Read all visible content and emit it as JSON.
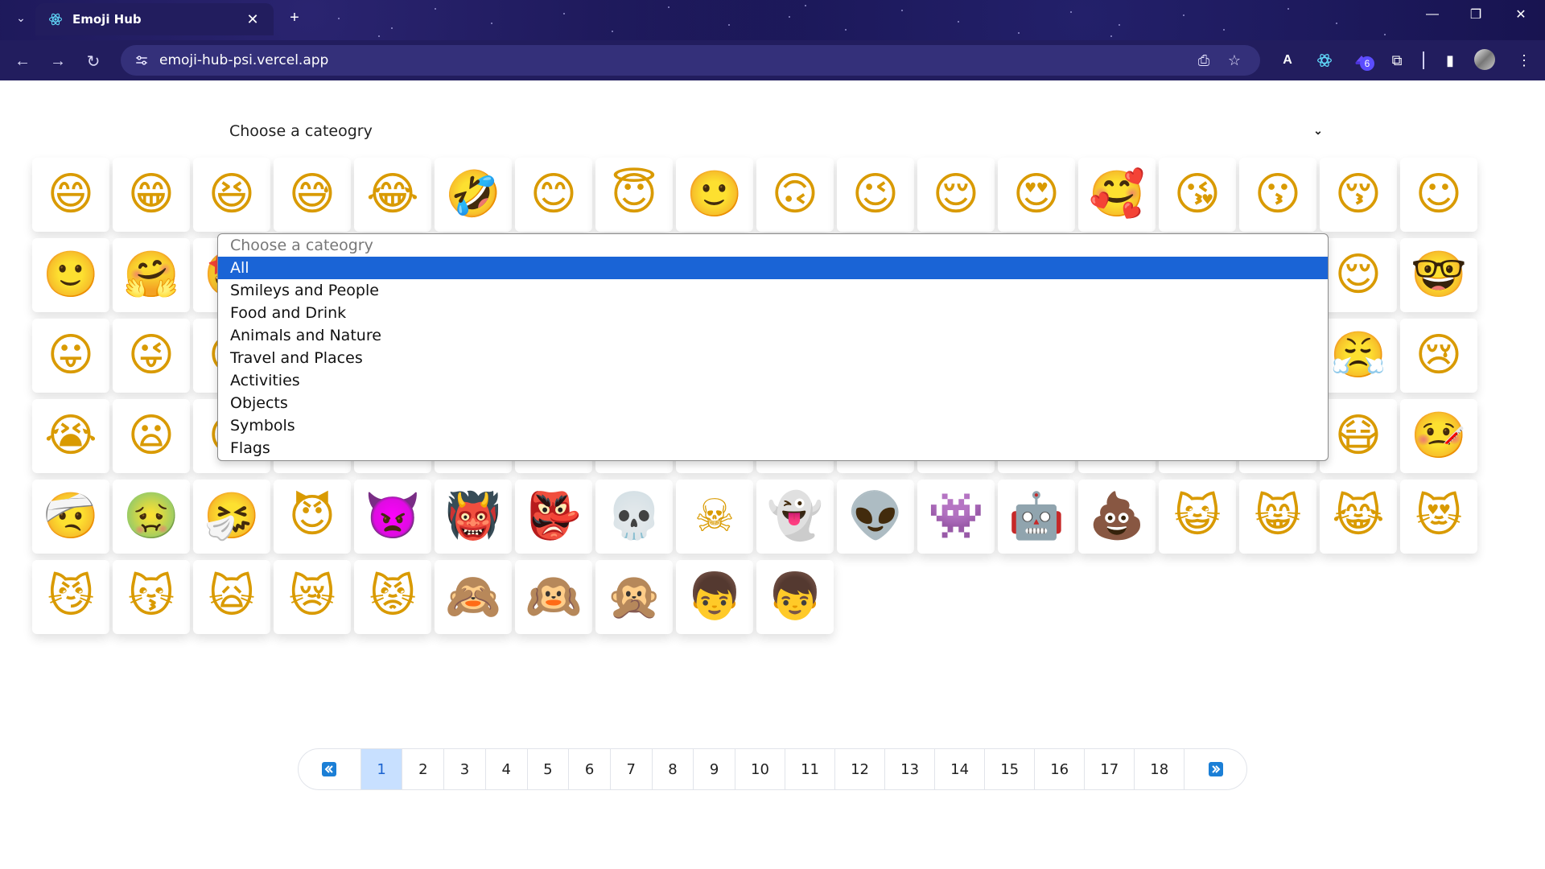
{
  "browser": {
    "tab_title": "Emoji Hub",
    "url": "emoji-hub-psi.vercel.app",
    "extension_badge": "6"
  },
  "category_select": {
    "placeholder": "Choose a cateogry",
    "options": [
      "Choose a cateogry",
      "All",
      "Smileys and People",
      "Food and Drink",
      "Animals and Nature",
      "Travel and Places",
      "Activities",
      "Objects",
      "Symbols",
      "Flags"
    ],
    "highlighted": "All"
  },
  "emojis": [
    [
      "😄",
      "😁",
      "😆",
      "😅",
      "😂",
      "🤣",
      "😊",
      "😇",
      "🙂",
      "🙃",
      "😉",
      "😌",
      "😍",
      "🥰",
      "😘",
      "😗",
      "😚",
      "☺"
    ],
    [
      "🙂",
      "🤗",
      "🤩",
      "🤔",
      "🤨",
      "😐",
      "😑",
      "😶",
      "🙄",
      "😏",
      "😣",
      "😥",
      "😮",
      "🤐",
      "😯",
      "😪",
      "😌",
      "🤓"
    ],
    [
      "😛",
      "😜",
      "😝",
      "🤤",
      "😒",
      "😓",
      "😔",
      "😕",
      "🙃",
      "🤑",
      "😲",
      "☹",
      "🙁",
      "😖",
      "😞",
      "😟",
      "😤",
      "😢"
    ],
    [
      "😭",
      "😦",
      "😧",
      "😨",
      "😩",
      "😬",
      "😰",
      "😱",
      "😳",
      "😵",
      "😡",
      "😠",
      "😇",
      "🤠",
      "🤡",
      "🤥",
      "😷",
      "🤒"
    ],
    [
      "🤕",
      "🤢",
      "🤧",
      "😈",
      "👿",
      "👹",
      "👺",
      "💀",
      "☠",
      "👻",
      "👽",
      "👾",
      "🤖",
      "💩",
      "😺",
      "😸",
      "😹",
      "😻"
    ],
    [
      "😼",
      "😽",
      "🙀",
      "😿",
      "😾",
      "🙈",
      "🙉",
      "🙊",
      "👦",
      "👦"
    ]
  ],
  "pagination": {
    "first_icon": "double-chevron-left-icon",
    "last_icon": "double-chevron-right-icon",
    "pages": [
      "1",
      "2",
      "3",
      "4",
      "5",
      "6",
      "7",
      "8",
      "9",
      "10",
      "11",
      "12",
      "13",
      "14",
      "15",
      "16",
      "17",
      "18"
    ],
    "current": "1"
  },
  "colors": {
    "chrome_bg": "#221d5e",
    "selected_option": "#1a64d6",
    "active_page": "#c8e0ff"
  }
}
